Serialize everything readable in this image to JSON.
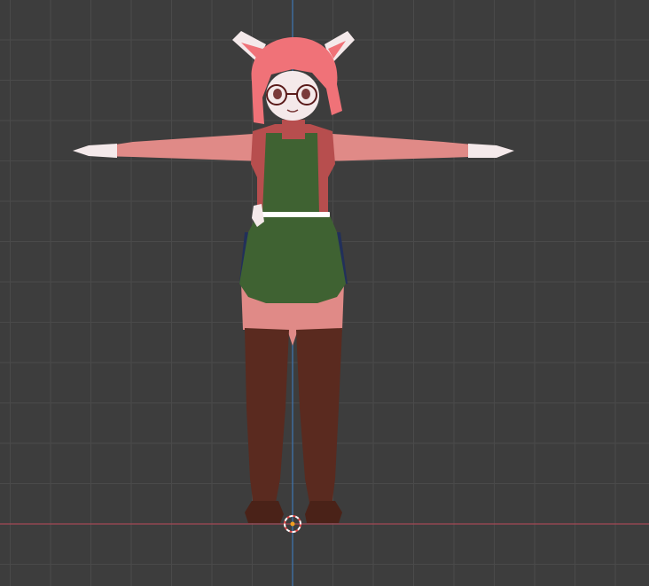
{
  "viewport": {
    "view": "front-orthographic",
    "background_color": "#3d3d3d",
    "grid_color": "#4a4a4a",
    "axis_colors": {
      "x_axis": "#a44a55",
      "z_axis": "#3f77b5"
    },
    "icons": {
      "origin_cursor": "3d-cursor-icon"
    }
  },
  "model": {
    "subject": "character-t-pose",
    "palette": {
      "skin": "#e08a87",
      "skin_dark": "#c96e6c",
      "hair": "#f07278",
      "ear_fur": "#f4e9ea",
      "apron": "#3f6232",
      "shirt": "#b74e4e",
      "stockings": "#5a2a1f",
      "feet": "#4a2218",
      "belt": "#ffffff",
      "skirt_trim": "#22305a",
      "glasses": "#5a1a1a",
      "eyes": "#7a3a3a"
    }
  }
}
